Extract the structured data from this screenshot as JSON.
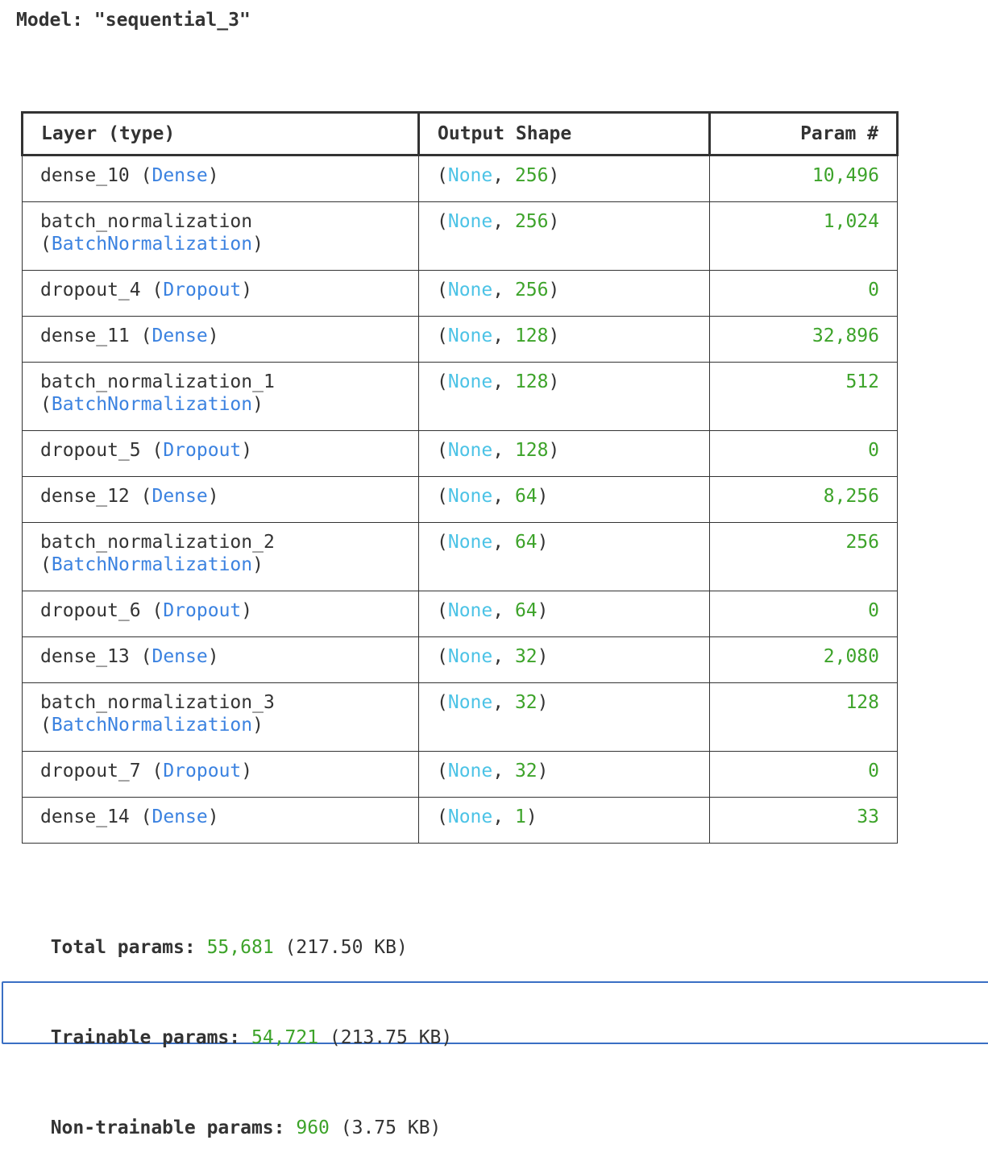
{
  "model": {
    "title": "Model: \"sequential_3\""
  },
  "table": {
    "headers": {
      "layer": "Layer (type)",
      "output_shape": "Output Shape",
      "params": "Param #"
    },
    "rows": [
      {
        "name": "dense_10",
        "type": "Dense",
        "wrap": false,
        "shape_none": "None",
        "shape_dim": "256",
        "params": "10,496"
      },
      {
        "name": "batch_normalization",
        "type": "BatchNormalization",
        "wrap": true,
        "shape_none": "None",
        "shape_dim": "256",
        "params": "1,024"
      },
      {
        "name": "dropout_4",
        "type": "Dropout",
        "wrap": false,
        "shape_none": "None",
        "shape_dim": "256",
        "params": "0"
      },
      {
        "name": "dense_11",
        "type": "Dense",
        "wrap": false,
        "shape_none": "None",
        "shape_dim": "128",
        "params": "32,896"
      },
      {
        "name": "batch_normalization_1",
        "type": "BatchNormalization",
        "wrap": true,
        "shape_none": "None",
        "shape_dim": "128",
        "params": "512"
      },
      {
        "name": "dropout_5",
        "type": "Dropout",
        "wrap": false,
        "shape_none": "None",
        "shape_dim": "128",
        "params": "0"
      },
      {
        "name": "dense_12",
        "type": "Dense",
        "wrap": false,
        "shape_none": "None",
        "shape_dim": "64",
        "params": "8,256"
      },
      {
        "name": "batch_normalization_2",
        "type": "BatchNormalization",
        "wrap": true,
        "shape_none": "None",
        "shape_dim": "64",
        "params": "256"
      },
      {
        "name": "dropout_6",
        "type": "Dropout",
        "wrap": false,
        "shape_none": "None",
        "shape_dim": "64",
        "params": "0"
      },
      {
        "name": "dense_13",
        "type": "Dense",
        "wrap": false,
        "shape_none": "None",
        "shape_dim": "32",
        "params": "2,080"
      },
      {
        "name": "batch_normalization_3",
        "type": "BatchNormalization",
        "wrap": true,
        "shape_none": "None",
        "shape_dim": "32",
        "params": "128"
      },
      {
        "name": "dropout_7",
        "type": "Dropout",
        "wrap": false,
        "shape_none": "None",
        "shape_dim": "32",
        "params": "0"
      },
      {
        "name": "dense_14",
        "type": "Dense",
        "wrap": false,
        "shape_none": "None",
        "shape_dim": "1",
        "params": "33"
      }
    ]
  },
  "stats": {
    "total": {
      "label": "Total params:",
      "value": "55,681",
      "size": "(217.50 KB)"
    },
    "trainable": {
      "label": "Trainable params:",
      "value": "54,721",
      "size": "(213.75 KB)"
    },
    "non_trainable": {
      "label": "Non-trainable params:",
      "value": "960",
      "size": "(3.75 KB)"
    }
  },
  "colors": {
    "layer_type": "#3b82e0",
    "none_keyword": "#4cc3e6",
    "number": "#3da32a",
    "text": "#333333",
    "focus_border": "#3a6fc4"
  }
}
